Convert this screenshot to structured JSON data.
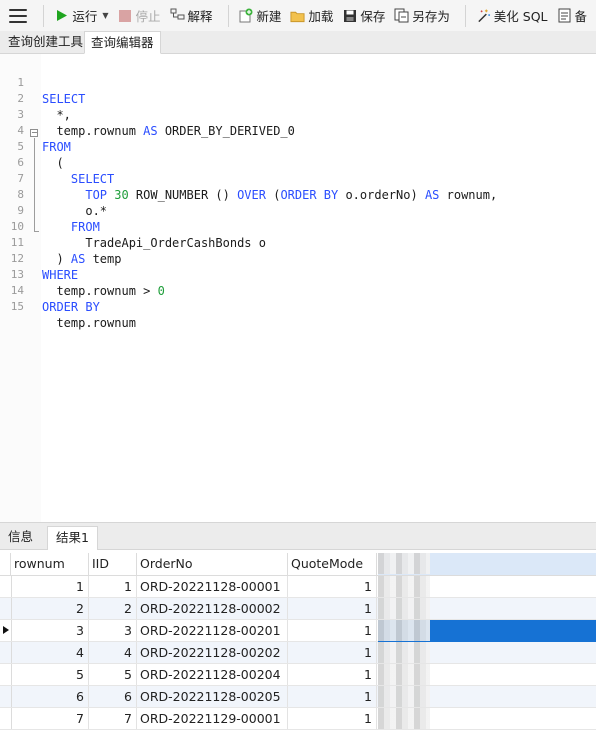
{
  "toolbar": {
    "run": "运行",
    "stop": "停止",
    "explain": "解释",
    "new": "新建",
    "load": "加载",
    "save": "保存",
    "save_as": "另存为",
    "beautify": "美化 SQL",
    "backup": "备"
  },
  "tabs": [
    "查询创建工具",
    "查询编辑器"
  ],
  "code_lines": [
    "1",
    "2",
    "3",
    "4",
    "5",
    "6",
    "7",
    "8",
    "9",
    "10",
    "11",
    "12",
    "13",
    "14",
    "15"
  ],
  "code": {
    "l1_kw": "SELECT",
    "l2": "  *,",
    "l3_a": "  temp.rownum ",
    "l3_kw": "AS",
    "l3_b": " ORDER_BY_DERIVED_0",
    "l4_kw": "FROM",
    "l5": "  (",
    "l6_kw": "    SELECT",
    "l7_kw1": "      TOP ",
    "l7_num": "30",
    "l7_a": " ROW_NUMBER () ",
    "l7_kw2": "OVER",
    "l7_b": " (",
    "l7_kw3": "ORDER BY",
    "l7_c": " o.orderNo) ",
    "l7_kw4": "AS",
    "l7_d": " rownum,",
    "l8": "      o.*",
    "l9_kw": "    FROM",
    "l10": "      TradeApi_OrderCashBonds o",
    "l11_a": "  ) ",
    "l11_kw": "AS",
    "l11_b": " temp",
    "l12_kw": "WHERE",
    "l13_a": "  temp.rownum > ",
    "l13_num": "0",
    "l14_kw": "ORDER BY",
    "l15": "  temp.rownum"
  },
  "result_tabs": [
    "信息",
    "结果1"
  ],
  "grid": {
    "columns": [
      "rownum",
      "IID",
      "OrderNo",
      "QuoteMode"
    ],
    "rows": [
      {
        "rownum": "1",
        "iid": "1",
        "order": "ORD-20221128-00001",
        "quote": "1"
      },
      {
        "rownum": "2",
        "iid": "2",
        "order": "ORD-20221128-00002",
        "quote": "1"
      },
      {
        "rownum": "3",
        "iid": "3",
        "order": "ORD-20221128-00201",
        "quote": "1"
      },
      {
        "rownum": "4",
        "iid": "4",
        "order": "ORD-20221128-00202",
        "quote": "1"
      },
      {
        "rownum": "5",
        "iid": "5",
        "order": "ORD-20221128-00204",
        "quote": "1"
      },
      {
        "rownum": "6",
        "iid": "6",
        "order": "ORD-20221128-00205",
        "quote": "1"
      },
      {
        "rownum": "7",
        "iid": "7",
        "order": "ORD-20221129-00001",
        "quote": "1"
      }
    ]
  },
  "colors": {
    "keyword": "#2a4dff",
    "number": "#1e9e3a",
    "selection": "#1672d4"
  }
}
